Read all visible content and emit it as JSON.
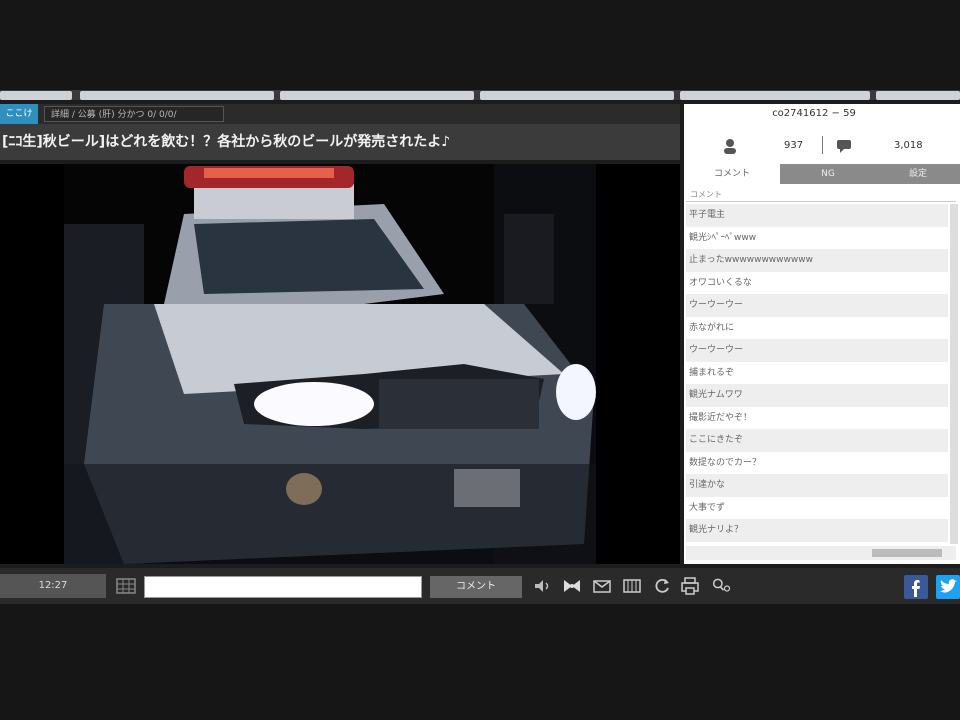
{
  "header": {
    "tab_active": "ここけ",
    "tab_inactive": "詳細 / 公募 (肝) 分かつ 0/ 0/0/",
    "title": "[ﾆｺ生]秋ビール]はどれを飲む！？各社から秋のビールが発売されたよ♪"
  },
  "stats": {
    "community_id": "co2741612 − 59",
    "viewers": "937",
    "comments_count": "3,018"
  },
  "comment_panel": {
    "tabs": [
      "コメント",
      "NG",
      "設定"
    ],
    "column_header": "コメント",
    "comments": [
      "平子電主",
      "観光ｼﾍﾟｰﾍﾟwww",
      "止まったwwwwwwwwwwww",
      "オワコいくるな",
      "ウーウーウー",
      "赤ながれに",
      "ウーウーウー",
      "捕まれるぞ",
      "観光ナムワワ",
      "撮影近だやぞ！",
      "ここにきたぞ",
      "数提なのでカー？",
      "引達かな",
      "大事でず",
      "観光ナリよ？"
    ]
  },
  "controls": {
    "time": "12:27",
    "comment_placeholder": "",
    "comment_button": "コメント"
  },
  "icons": [
    "play-volume-icon",
    "ribbon-icon",
    "mail-icon",
    "film-icon",
    "refresh-icon",
    "print-icon",
    "search-users-icon",
    "facebook-icon",
    "twitter-icon"
  ],
  "colors": {
    "accent": "#2f8fbf",
    "facebook": "#3b5998",
    "twitter": "#1da1f2"
  }
}
